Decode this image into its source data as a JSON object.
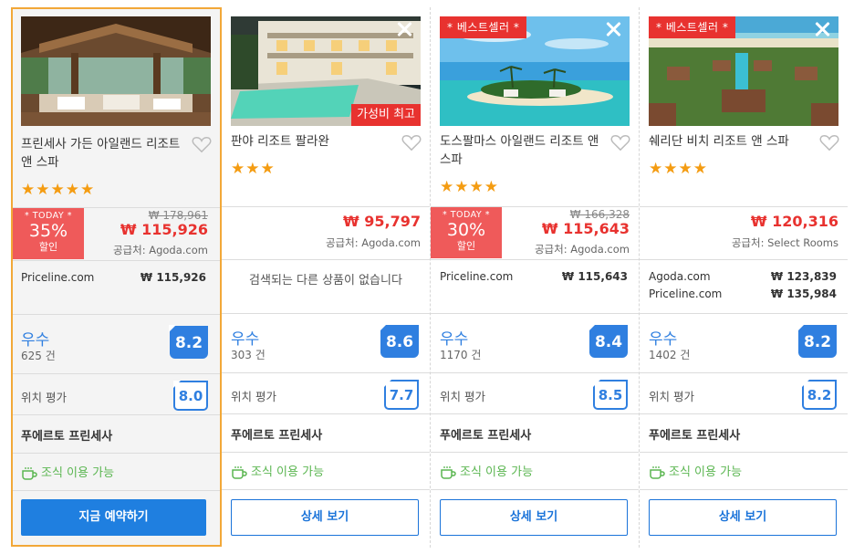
{
  "hotels": [
    {
      "name": "프린세사 가든 아일랜드 리조트 앤 스파",
      "stars": "★★★★★",
      "today": {
        "label": "* TODAY *",
        "percent": "35%",
        "suffix": "할인"
      },
      "original_price": "₩ 178,961",
      "price": "₩ 115,926",
      "supplier": "공급처: Agoda.com",
      "otas": [
        {
          "name": "Priceline.com",
          "price": "₩ 115,926"
        }
      ],
      "rating_word": "우수",
      "review_count": "625 건",
      "score": "8.2",
      "location_label": "위치 평가",
      "location_score": "8.0",
      "area": "푸에르토 프린세사",
      "breakfast": "조식 이용 가능",
      "button": "지금 예약하기",
      "highlighted": true
    },
    {
      "name": "판야 리조트 팔라완",
      "stars": "★★★",
      "value_badge": "가성비 최고",
      "price": "₩ 95,797",
      "supplier": "공급처: Agoda.com",
      "no_results": "검색되는 다른 상품이 없습니다",
      "rating_word": "우수",
      "review_count": "303 건",
      "score": "8.6",
      "location_label": "위치 평가",
      "location_score": "7.7",
      "area": "푸에르토 프린세사",
      "breakfast": "조식 이용 가능",
      "button": "상세 보기"
    },
    {
      "name": "도스팔마스 아일랜드 리조트 앤 스파",
      "stars": "★★★★",
      "best_badge": "* 베스트셀러 *",
      "today": {
        "label": "* TODAY *",
        "percent": "30%",
        "suffix": "할인"
      },
      "original_price": "₩ 166,328",
      "price": "₩ 115,643",
      "supplier": "공급처: Agoda.com",
      "otas": [
        {
          "name": "Priceline.com",
          "price": "₩ 115,643"
        }
      ],
      "rating_word": "우수",
      "review_count": "1170 건",
      "score": "8.4",
      "location_label": "위치 평가",
      "location_score": "8.5",
      "area": "푸에르토 프린세사",
      "breakfast": "조식 이용 가능",
      "button": "상세 보기"
    },
    {
      "name": "쉐리단 비치 리조트 앤 스파",
      "stars": "★★★★",
      "best_badge": "* 베스트셀러 *",
      "price": "₩ 120,316",
      "supplier": "공급처: Select Rooms",
      "otas": [
        {
          "name": "Agoda.com",
          "price": "₩ 123,839"
        },
        {
          "name": "Priceline.com",
          "price": "₩ 135,984"
        }
      ],
      "rating_word": "우수",
      "review_count": "1402 건",
      "score": "8.2",
      "location_label": "위치 평가",
      "location_score": "8.2",
      "area": "푸에르토 프린세사",
      "breakfast": "조식 이용 가능",
      "button": "상세 보기"
    }
  ],
  "colors": {
    "accent_blue": "#2f7fe0",
    "price_red": "#e8322f",
    "today_red": "#ef5a5a",
    "star_orange": "#f49c12",
    "breakfast_green": "#5bb651",
    "highlight_border": "#f2a838"
  }
}
